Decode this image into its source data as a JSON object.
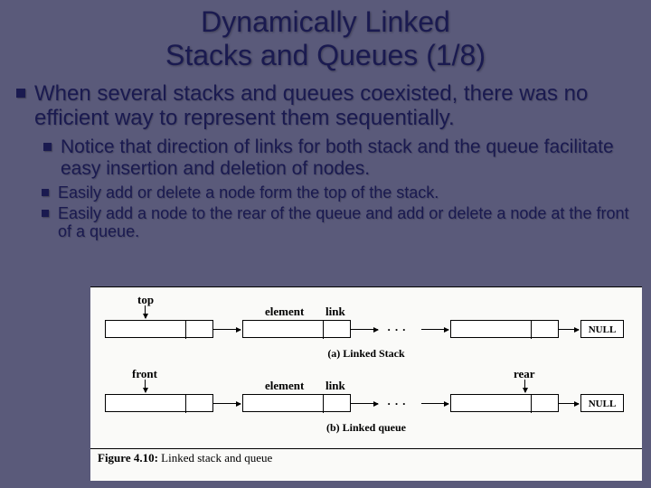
{
  "title_line1": "Dynamically Linked",
  "title_line2": "Stacks and Queues (1/8)",
  "bullets": {
    "b1": "When several stacks and queues coexisted, there was no efficient way to represent them sequentially.",
    "b2": "Notice that direction of links for both stack and the queue facilitate easy insertion and deletion of nodes.",
    "b3": "Easily add or delete a node form the top of the stack.",
    "b4": "Easily add a node to the rear of the queue and add or delete a node at the front of a queue."
  },
  "figure": {
    "top": "top",
    "front": "front",
    "rear": "rear",
    "element": "element",
    "link": "link",
    "null": "NULL",
    "sub_a": "(a) Linked Stack",
    "sub_b": "(b) Linked queue",
    "caption_bold": "Figure 4.10:",
    "caption_rest": " Linked stack and queue"
  }
}
